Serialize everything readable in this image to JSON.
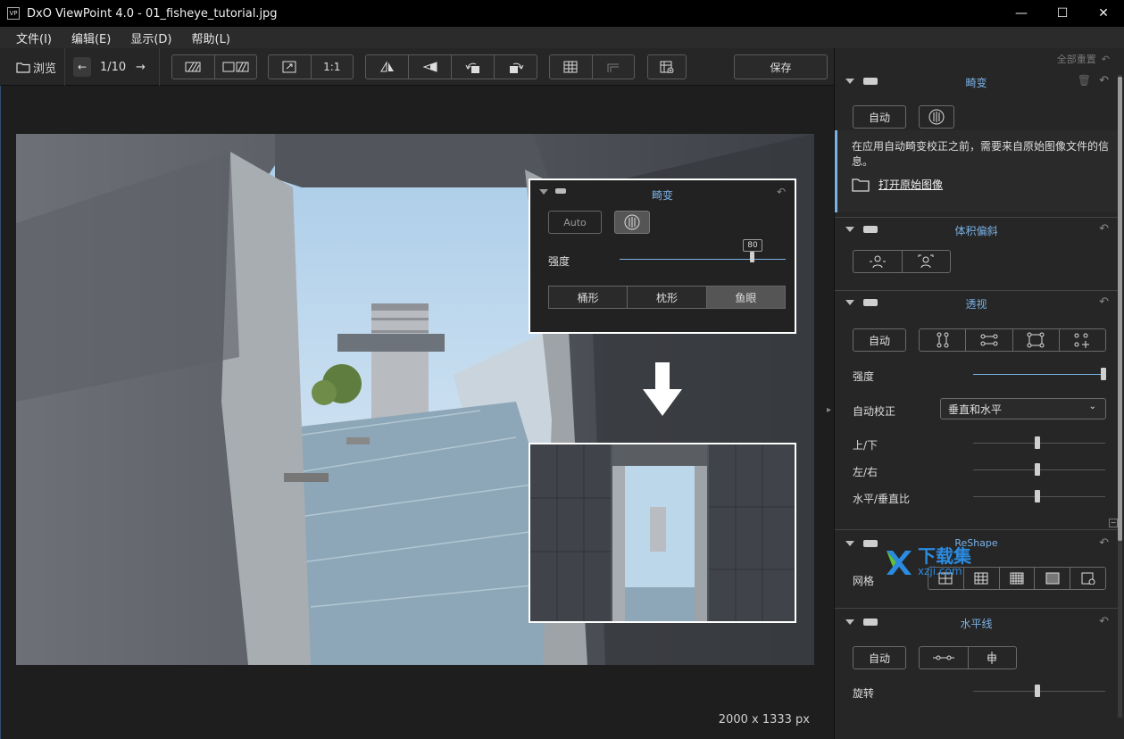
{
  "window": {
    "title": "DxO ViewPoint 4.0 - 01_fisheye_tutorial.jpg",
    "app_icon_text": "VP",
    "minimize": "—",
    "maximize": "☐",
    "close": "✕"
  },
  "menu": [
    "文件(I)",
    "编辑(E)",
    "显示(D)",
    "帮助(L)"
  ],
  "toolbar": {
    "browse_label": "浏览",
    "page_counter": "1/10",
    "zoom_one_to_one": "1:1",
    "save_label": "保存"
  },
  "viewer": {
    "dimensions": "2000 x 1333 px"
  },
  "overlay": {
    "title": "畸变",
    "auto_label": "Auto",
    "strength_label": "强度",
    "strength_value": "80",
    "modes": [
      "桶形",
      "枕形",
      "鱼眼"
    ]
  },
  "panel": {
    "reset_all": "全部重置",
    "distortion": {
      "title": "畸变",
      "auto_label": "自动",
      "info_text": "在应用自动畸变校正之前，需要来自原始图像文件的信息。",
      "open_original": "打开原始图像"
    },
    "volume": {
      "title": "体积偏斜"
    },
    "perspective": {
      "title": "透视",
      "auto_label": "自动",
      "strength_label": "强度",
      "auto_correct_label": "自动校正",
      "auto_correct_value": "垂直和水平",
      "updown_label": "上/下",
      "leftright_label": "左/右",
      "ratio_label": "水平/垂直比"
    },
    "reshape": {
      "title": "ReShape",
      "grid_label": "网格"
    },
    "horizon": {
      "title": "水平线",
      "auto_label": "自动",
      "rotate_label": "旋转"
    }
  },
  "watermark": {
    "text_cn": "下载集",
    "text_url": "xzji.com"
  },
  "colors": {
    "accent": "#7bb2e6",
    "panel_bg": "#262626",
    "viewer_bg": "#1e1e1e"
  }
}
